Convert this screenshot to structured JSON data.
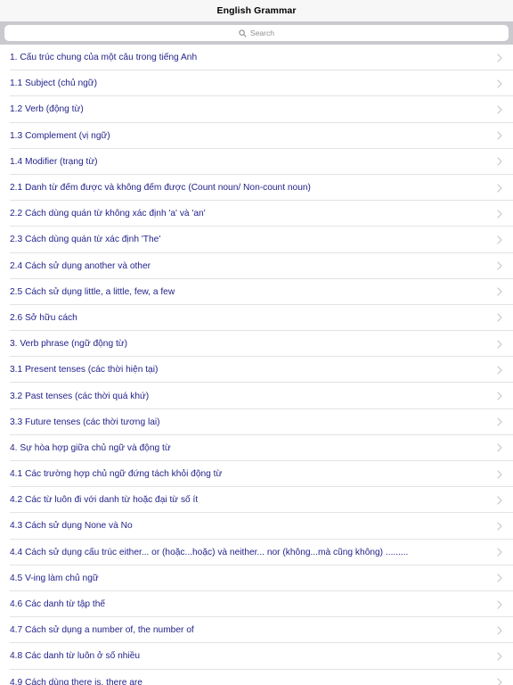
{
  "header": {
    "title": "English Grammar"
  },
  "search": {
    "placeholder": "Search",
    "icon": "search-icon"
  },
  "colors": {
    "row_text": "#1f1f8a",
    "search_bar_bg": "#c9c9ce",
    "chevron": "#c7c7cc"
  },
  "list": {
    "items": [
      {
        "label": "1. Cấu trúc chung của một câu trong tiếng Anh"
      },
      {
        "label": "1.1 Subject (chủ ngữ)"
      },
      {
        "label": "1.2 Verb (động từ)"
      },
      {
        "label": "1.3 Complement (vị ngữ)"
      },
      {
        "label": "1.4 Modifier (trạng từ)"
      },
      {
        "label": "2.1 Danh từ đếm được và không đếm được (Count noun/ Non-count noun)"
      },
      {
        "label": "2.2 Cách dùng quán từ không xác định 'a' và 'an'"
      },
      {
        "label": "2.3 Cách dùng quán từ xác định 'The'"
      },
      {
        "label": "2.4 Cách sử dụng another và other"
      },
      {
        "label": "2.5 Cách sử dụng little, a little, few, a few"
      },
      {
        "label": "2.6 Sở hữu cách"
      },
      {
        "label": "3. Verb phrase (ngữ động từ)"
      },
      {
        "label": "3.1 Present tenses (các thời hiện tại)"
      },
      {
        "label": "3.2 Past tenses (các thời quá khứ)"
      },
      {
        "label": "3.3 Future tenses (các thời tương lai)"
      },
      {
        "label": "4. Sự hòa hợp giữa chủ ngữ và động từ"
      },
      {
        "label": "4.1 Các trường hợp chủ ngữ đứng tách khỏi động từ"
      },
      {
        "label": "4.2 Các từ luôn đi với danh từ hoặc đại từ số ít"
      },
      {
        "label": "4.3 Cách sử dụng None và No"
      },
      {
        "label": "4.4 Cách sử dụng cấu trúc either... or (hoặc...hoặc) và neither... nor (không...mà cũng không) ........."
      },
      {
        "label": "4.5 V-ing làm chủ ngữ"
      },
      {
        "label": "4.6 Các danh từ tập thể"
      },
      {
        "label": "4.7 Cách sử dụng a number of, the number of"
      },
      {
        "label": "4.8 Các danh từ luôn ở số nhiều"
      },
      {
        "label": "4.9 Cách dùng there is, there are"
      }
    ]
  }
}
